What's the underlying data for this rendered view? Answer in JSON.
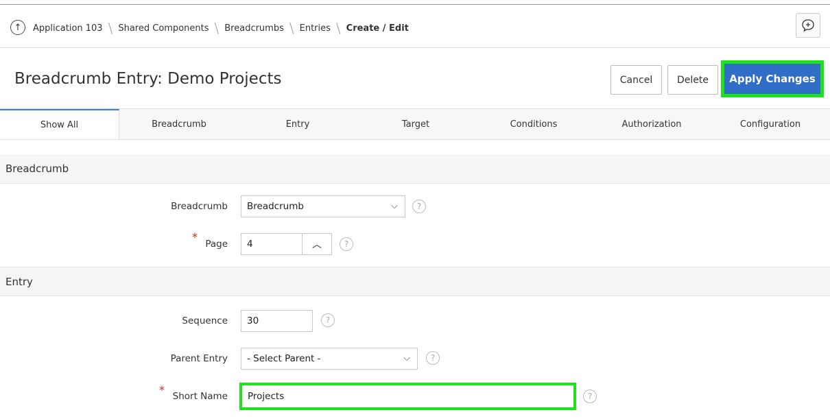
{
  "breadcrumb": {
    "items": [
      "Application 103",
      "Shared Components",
      "Breadcrumbs",
      "Entries"
    ],
    "current": "Create / Edit"
  },
  "page": {
    "title": "Breadcrumb Entry: Demo Projects"
  },
  "buttons": {
    "cancel": "Cancel",
    "delete": "Delete",
    "apply": "Apply Changes"
  },
  "tabs": [
    "Show All",
    "Breadcrumb",
    "Entry",
    "Target",
    "Conditions",
    "Authorization",
    "Configuration"
  ],
  "sections": {
    "breadcrumb": {
      "heading": "Breadcrumb",
      "breadcrumb_label": "Breadcrumb",
      "breadcrumb_value": "Breadcrumb",
      "page_label": "Page",
      "page_value": "4"
    },
    "entry": {
      "heading": "Entry",
      "sequence_label": "Sequence",
      "sequence_value": "30",
      "parent_label": "Parent Entry",
      "parent_value": "- Select Parent -",
      "short_name_label": "Short Name",
      "short_name_value": "Projects"
    }
  },
  "colors": {
    "accent": "#2f6ec4",
    "highlight": "#1de21d",
    "required": "#e02020"
  }
}
